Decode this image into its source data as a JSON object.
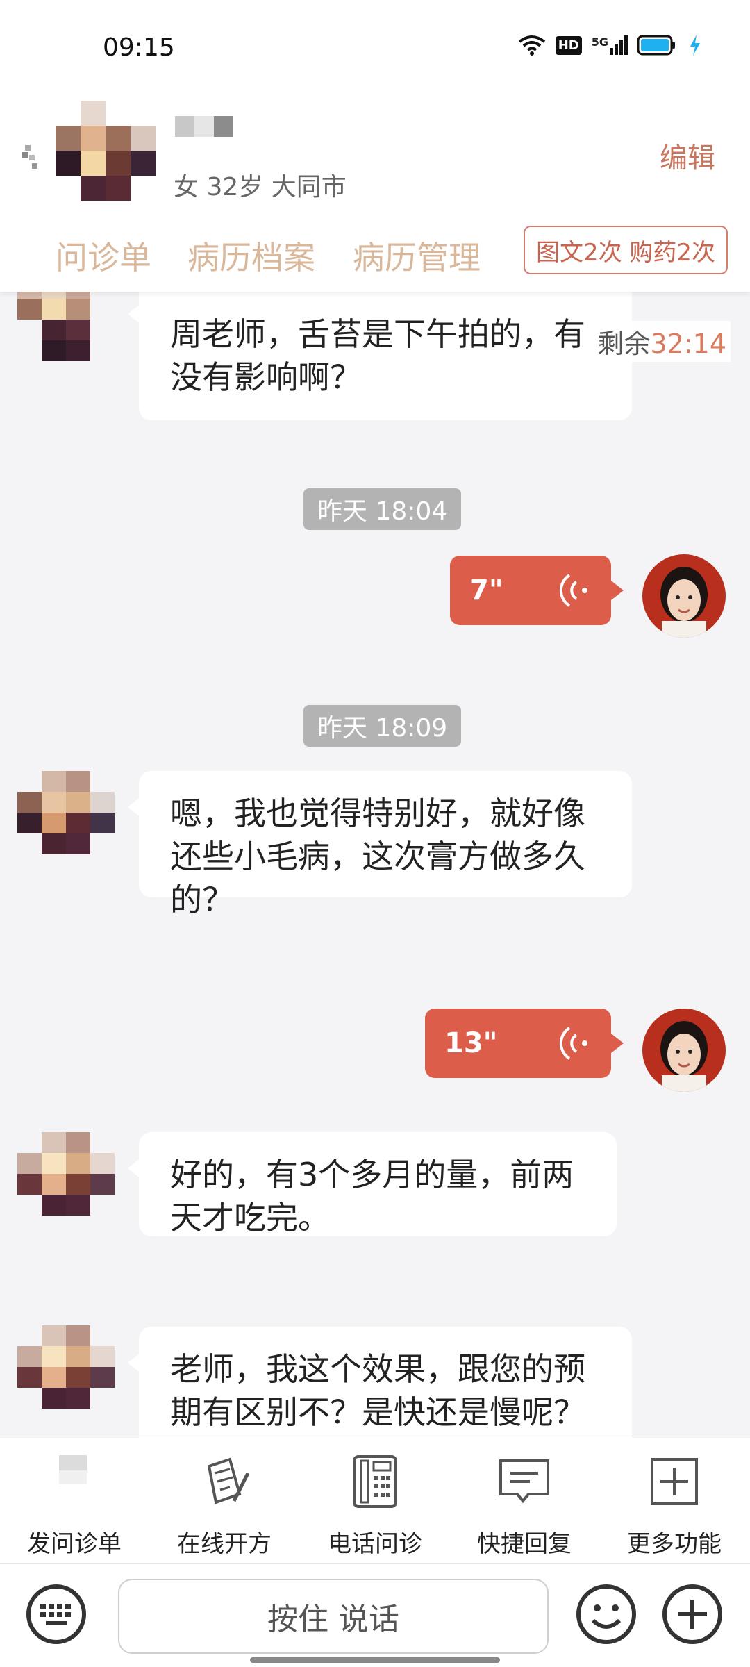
{
  "status_bar": {
    "time": "09:15",
    "hd": "HD",
    "network": "5G"
  },
  "header": {
    "patient_info": "女 32岁  大同市",
    "edit_label": "编辑",
    "tabs": [
      "问诊单",
      "病历档案",
      "病历管理"
    ],
    "quota": "图文2次 购药2次"
  },
  "chat": {
    "remaining_label": "剩余",
    "remaining_time": "32:14",
    "messages": [
      {
        "text": "周老师，舌苔是下午拍的，有没有影响啊？"
      },
      {
        "time": "昨天 18:04"
      },
      {
        "voice": "7\""
      },
      {
        "time": "昨天 18:09"
      },
      {
        "text": "嗯，我也觉得特别好，就好像还些小毛病，这次膏方做多久的？"
      },
      {
        "voice": "13\""
      },
      {
        "text": "好的，有3个多月的量，前两天才吃完。"
      },
      {
        "text": "老师，我这个效果，跟您的预期有区别不？是快还是慢呢？"
      }
    ]
  },
  "toolbar": {
    "items": [
      "发问诊单",
      "在线开方",
      "电话问诊",
      "快捷回复",
      "更多功能"
    ]
  },
  "input": {
    "hold_to_talk": "按住 说话"
  },
  "colors": {
    "accent": "#dd5d4b",
    "tab": "#d9b79a",
    "edit": "#c9765f"
  }
}
